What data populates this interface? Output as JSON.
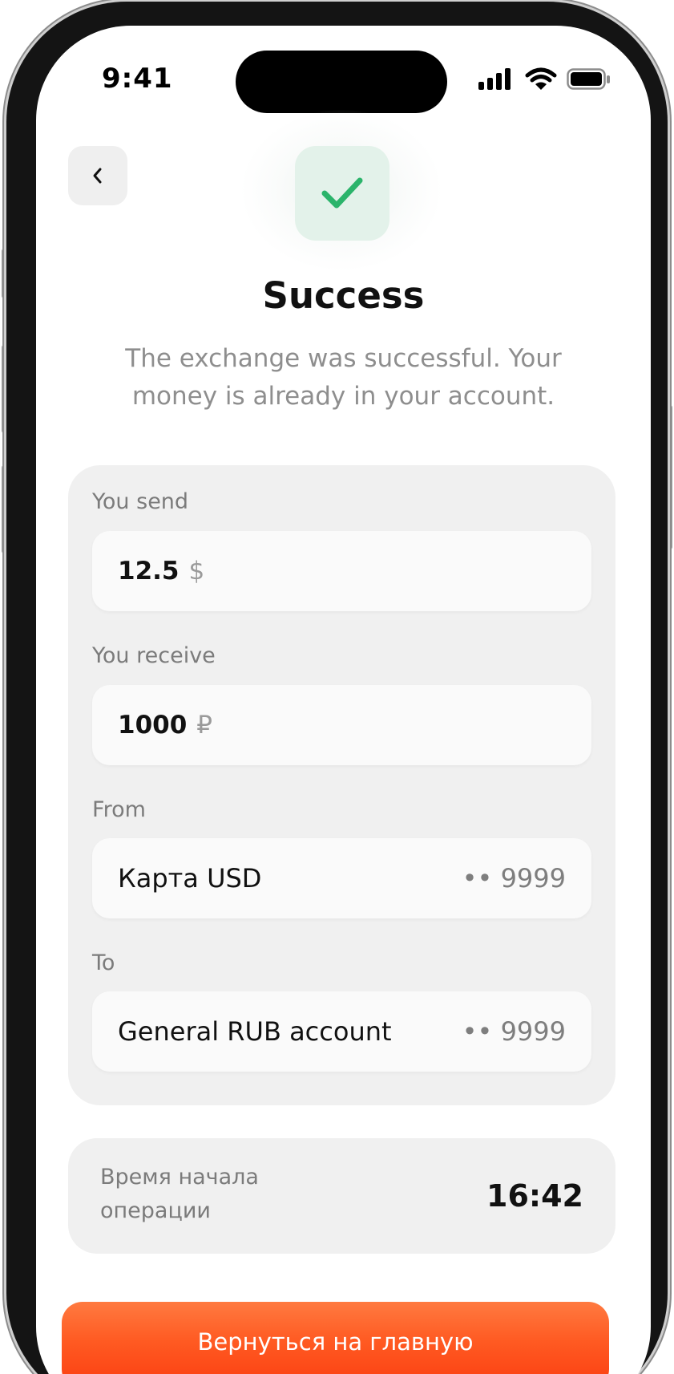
{
  "status_bar": {
    "time": "9:41"
  },
  "header": {
    "back_icon": "chevron-left-icon",
    "status_icon": "checkmark-icon",
    "title": "Success",
    "subtitle": "The exchange was successful. Your money is already in your account."
  },
  "details": {
    "send": {
      "label": "You send",
      "amount": "12.5",
      "currency": "$"
    },
    "receive": {
      "label": "You receive",
      "amount": "1000",
      "currency": "₽"
    },
    "from": {
      "label": "From",
      "account_name": "Карта USD",
      "account_mask": "•• 9999"
    },
    "to": {
      "label": "To",
      "account_name": "General RUB account",
      "account_mask": "•• 9999"
    }
  },
  "operation": {
    "label": "Время начала операции",
    "time": "16:42"
  },
  "actions": {
    "home_label": "Вернуться на главную"
  },
  "colors": {
    "accent": "#FF5A22",
    "success": "#2BB46B",
    "card_background": "#F0F0F0"
  }
}
